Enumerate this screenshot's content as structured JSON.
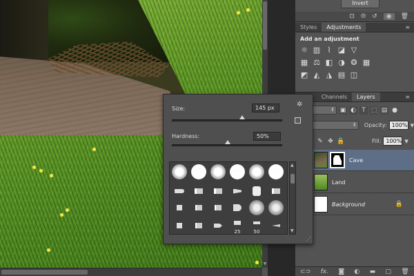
{
  "adjustment_strip": {
    "invert_label": "Invert",
    "footer_icons": [
      "clip-icon",
      "view-previous-icon",
      "reset-icon",
      "visibility-icon",
      "trash-icon"
    ]
  },
  "adjustments_panel": {
    "tabs": [
      {
        "label": "Styles",
        "active": false
      },
      {
        "label": "Adjustments",
        "active": true
      }
    ],
    "heading": "Add an adjustment",
    "row1_icons": [
      "brightness-icon",
      "levels-icon",
      "curves-icon",
      "exposure-icon",
      "gradient-triangle-icon"
    ],
    "row2_icons": [
      "vibrance-icon",
      "balance-icon",
      "black-white-icon",
      "photo-filter-icon",
      "channel-mixer-icon",
      "color-lookup-icon"
    ],
    "row3_icons": [
      "invert-icon",
      "posterize-icon",
      "threshold-icon",
      "gradient-map-icon",
      "selective-color-icon"
    ]
  },
  "layers_panel": {
    "tabs": [
      {
        "label": "Channels",
        "active": false
      },
      {
        "label": "Layers",
        "active": true
      }
    ],
    "filter_label": "ind",
    "blend_mode": "mal",
    "opacity_label": "Opacity:",
    "opacity_value": "100%",
    "fill_label": "Fill:",
    "fill_value": "100%",
    "layers": [
      {
        "name": "Cave",
        "selected": true,
        "italic": false,
        "locked": false
      },
      {
        "name": "Land",
        "selected": false,
        "italic": false,
        "locked": false
      },
      {
        "name": "Background",
        "selected": false,
        "italic": true,
        "locked": true
      }
    ],
    "footer_icons": [
      "link-icon",
      "fx-icon",
      "mask-icon",
      "adjustment-icon",
      "folder-icon",
      "new-layer-icon",
      "trash-icon"
    ]
  },
  "brush_popup": {
    "size_label": "Size:",
    "size_value": "145 px",
    "size_level_percent": 63,
    "hardness_label": "Hardness:",
    "hardness_value": "50%",
    "hardness_level_percent": 50,
    "brush_sizes": [
      "25",
      "50"
    ]
  },
  "colors": {
    "selected_layer": "#5e6e86",
    "panel_bg": "#535353",
    "flower": "#f1e84a"
  }
}
